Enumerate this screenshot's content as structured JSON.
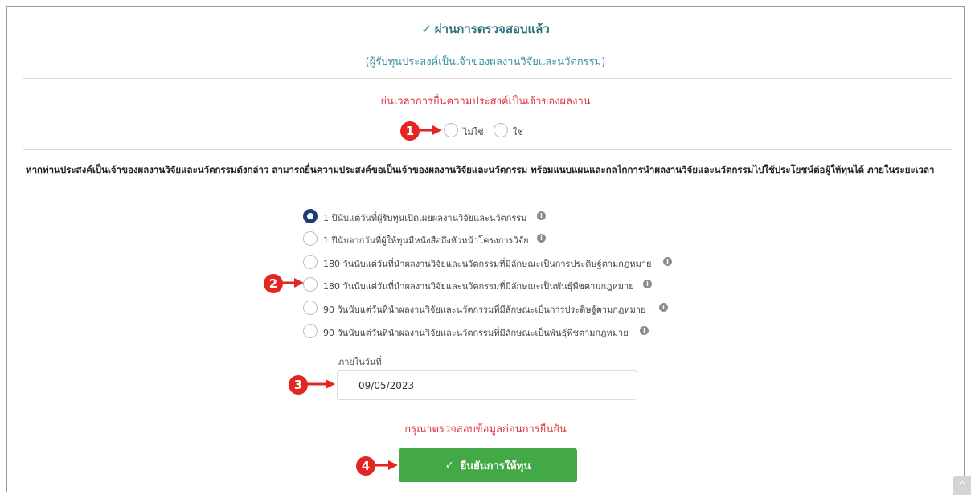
{
  "header": {
    "status_icon": "checkmark-icon",
    "status_text": "ผ่านการตรวจสอบแล้ว",
    "subtitle": "(ผู้รับทุนประสงค์เป็นเจ้าของผลงานวิจัยและนวัตกรรม)"
  },
  "ownership": {
    "question": "ย่นเวลาการยื่นความประสงค์เป็นเจ้าของผลงาน",
    "options": [
      {
        "label": "ไม่ใช่",
        "selected": false
      },
      {
        "label": "ใช่",
        "selected": false
      }
    ]
  },
  "description": "หากท่านประสงค์เป็นเจ้าของผลงานวิจัยและนวัตกรรมดังกล่าว สามารถยื่นความประสงค์ขอเป็นเจ้าของผลงานวิจัยและนวัตกรรม พร้อมแนบแผนและกลไกการนำผลงานวิจัยและนวัตกรรมไปใช้ประโยชน์ต่อผู้ให้ทุนได้ ภายในระยะเวลา",
  "period_options": [
    {
      "label": "1 ปีนับแต่วันที่ผู้รับทุนเปิดเผยผลงานวิจัยและนวัตกรรม",
      "selected": true,
      "info_icon": "info-icon"
    },
    {
      "label": "1 ปีนับจากวันที่ผู้ให้ทุนมีหนังสือถึงหัวหน้าโครงการวิจัย",
      "selected": false,
      "info_icon": "info-icon"
    },
    {
      "label": "180 วันนับแต่วันที่นำผลงานวิจัยและนวัตกรรมที่มีลักษณะเป็นการประดิษฐ์ตามกฎหมาย",
      "selected": false,
      "info_icon": "info-icon"
    },
    {
      "label": "180 วันนับแต่วันที่นำผลงานวิจัยและนวัตกรรมที่มีลักษณะเป็นพันธุ์พืชตามกฎหมาย",
      "selected": false,
      "info_icon": "info-icon"
    },
    {
      "label": "90 วันนับแต่วันที่นำผลงานวิจัยและนวัตกรรมที่มีลักษณะเป็นการประดิษฐ์ตามกฎหมาย",
      "selected": false,
      "info_icon": "info-icon"
    },
    {
      "label": "90 วันนับแต่วันที่นำผลงานวิจัยและนวัตกรรมที่มีลักษณะเป็นพันธุ์พืชตามกฎหมาย",
      "selected": false,
      "info_icon": "info-icon"
    }
  ],
  "date_field": {
    "label": "ภายในวันที่",
    "value": "09/05/2023"
  },
  "warning": "กรุณาตรวจสอบข้อมูลก่อนการยืนยัน",
  "confirm_button": {
    "icon": "checkmark-icon",
    "label": "ยืนยันการให้ทุน"
  },
  "markers": [
    "1",
    "2",
    "3",
    "4"
  ],
  "colors": {
    "accent_teal": "#2f6f7b",
    "warning_red": "#e0353b",
    "confirm_green": "#43a947",
    "radio_selected": "#1f3b73",
    "marker_red": "#e32622"
  }
}
